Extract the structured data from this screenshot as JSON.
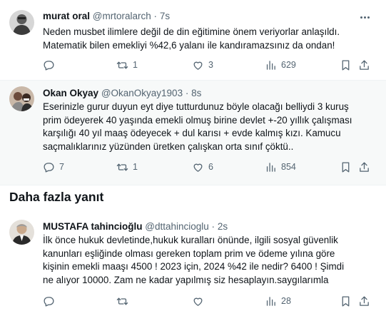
{
  "tweets": [
    {
      "name": "murat oral",
      "handle": "@mrtoralarch",
      "separator": "·",
      "time": "7s",
      "lines": [
        "Neden musbet ilimlere değil de din eğitimine  önem veriyorlar anlaşıldı.",
        "Matematik bilen emekliyi %42,6 yalanı ile kandıramazsınız da ondan!"
      ],
      "reply_count": "",
      "retweet_count": "1",
      "like_count": "3",
      "view_count": "629"
    },
    {
      "name": "Okan Okyay",
      "handle": "@OkanOkyay1903",
      "separator": "·",
      "time": "8s",
      "lines": [
        "Eserinizle gurur duyun eyt diye tutturdunuz böyle olacağı belliydi 3 kuruş",
        "prim ödeyerek 40 yaşında emekli olmuş birine devlet +-20 yıllık çalışması",
        "karşılığı 40 yıl maaş ödeyecek + dul karısı + evde kalmış kızı. Kamucu",
        "saçmalıklarınız yüzünden üretken çalışkan orta sınıf çöktü.."
      ],
      "reply_count": "7",
      "retweet_count": "1",
      "like_count": "6",
      "view_count": "854"
    },
    {
      "name": "MUSTAFA tahincioğlu",
      "handle": "@dttahincioglu",
      "separator": "·",
      "time": "2s",
      "lines": [
        "İlk önce hukuk devletinde,hukuk kuralları önünde, ilgili sosyal güvenlik",
        "kanunları eşliğinde olması gereken toplam prim ve ödeme yılına göre",
        "kişinin  emekli maaşı 4500 ! 2023 için, 2024 %42 ile nedir? 6400 ! Şimdi",
        "ne alıyor 10000. Zam ne kadar yapılmış siz hesaplayın.saygılarımla"
      ],
      "reply_count": "",
      "retweet_count": "",
      "like_count": "",
      "view_count": "28"
    }
  ],
  "section": {
    "title": "Daha fazla yanıt"
  },
  "icons": {
    "more": "more-horizontal-icon",
    "reply": "reply-icon",
    "retweet": "retweet-icon",
    "like": "heart-icon",
    "views": "views-chart-icon",
    "bookmark": "bookmark-icon",
    "share": "share-icon"
  },
  "colors": {
    "text": "#0f1419",
    "secondary": "#536471",
    "highlight_bg": "#f7f9f9",
    "divider": "#eff3f4"
  }
}
